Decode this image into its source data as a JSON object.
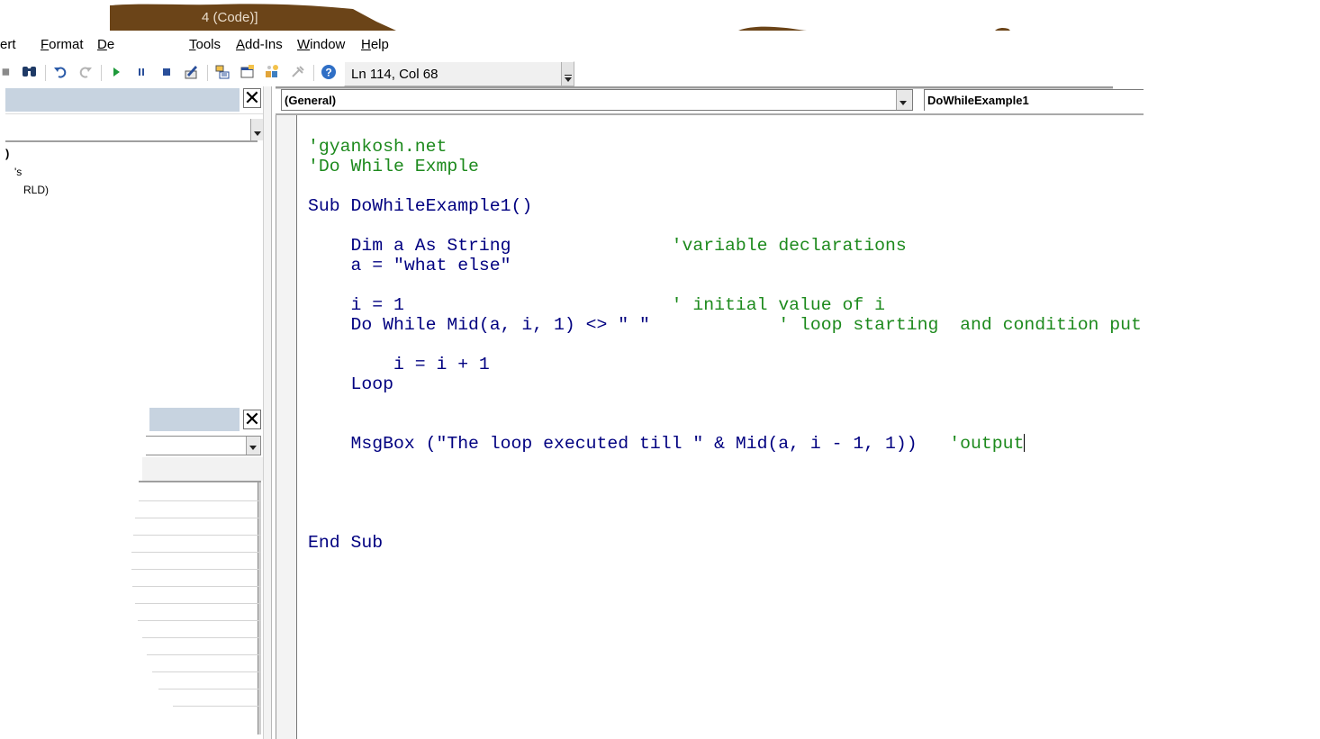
{
  "window": {
    "title": "(Code)",
    "title_bar_color": "#6b4418"
  },
  "menu": {
    "items": [
      {
        "label": "ert",
        "mnemonic": "",
        "rest": ""
      },
      {
        "label": "",
        "mnemonic": "F",
        "rest": "ormat"
      },
      {
        "label": "",
        "mnemonic": "D",
        "rest": "e"
      },
      {
        "label": "",
        "mnemonic": "T",
        "rest": "ools"
      },
      {
        "label": "",
        "mnemonic": "A",
        "rest": "dd-Ins"
      },
      {
        "label": "",
        "mnemonic": "W",
        "rest": "indow"
      },
      {
        "label": "",
        "mnemonic": "H",
        "rest": "elp"
      }
    ]
  },
  "toolbar": {
    "icons": [
      "save-icon",
      "find-icon",
      "undo-icon",
      "redo-icon",
      "run-icon",
      "break-icon",
      "reset-icon",
      "design-mode-icon",
      "project-explorer-icon",
      "properties-window-icon",
      "object-browser-icon",
      "toolbox-icon",
      "help-icon"
    ],
    "status": "Ln 114, Col 68"
  },
  "project_pane": {
    "tree": [
      ")",
      "'s",
      "RLD)"
    ]
  },
  "code_window": {
    "object_combo": "(General)",
    "procedure_combo": "DoWhileExample1",
    "lines": [
      {
        "indent": "",
        "code": "",
        "comment": "'gyankosh.net"
      },
      {
        "indent": "",
        "code": "",
        "comment": "'Do While Exmple"
      },
      {
        "indent": "",
        "code": "",
        "comment": ""
      },
      {
        "indent": "",
        "code": "Sub DoWhileExample1()",
        "comment": ""
      },
      {
        "indent": "",
        "code": "",
        "comment": ""
      },
      {
        "indent": "    ",
        "code": "Dim a As String               ",
        "comment": "'variable declarations"
      },
      {
        "indent": "    ",
        "code": "a = \"what else\"",
        "comment": ""
      },
      {
        "indent": "",
        "code": "",
        "comment": ""
      },
      {
        "indent": "    ",
        "code": "i = 1                         ",
        "comment": "' initial value of i"
      },
      {
        "indent": "    ",
        "code": "Do While Mid(a, i, 1) <> \" \"            ",
        "comment": "' loop starting  and condition put"
      },
      {
        "indent": "",
        "code": "",
        "comment": ""
      },
      {
        "indent": "        ",
        "code": "i = i + 1",
        "comment": ""
      },
      {
        "indent": "    ",
        "code": "Loop",
        "comment": ""
      },
      {
        "indent": "",
        "code": "",
        "comment": ""
      },
      {
        "indent": "",
        "code": "",
        "comment": ""
      },
      {
        "indent": "    ",
        "code": "MsgBox (\"The loop executed till \" & Mid(a, i - 1, 1))   ",
        "comment": "'output",
        "caret": true
      },
      {
        "indent": "",
        "code": "",
        "comment": ""
      },
      {
        "indent": "",
        "code": "",
        "comment": ""
      },
      {
        "indent": "",
        "code": "",
        "comment": ""
      },
      {
        "indent": "",
        "code": "",
        "comment": ""
      },
      {
        "indent": "",
        "code": "End Sub",
        "comment": ""
      }
    ],
    "comment_color": "#1d8a1d",
    "keyword_color": "#000080"
  }
}
